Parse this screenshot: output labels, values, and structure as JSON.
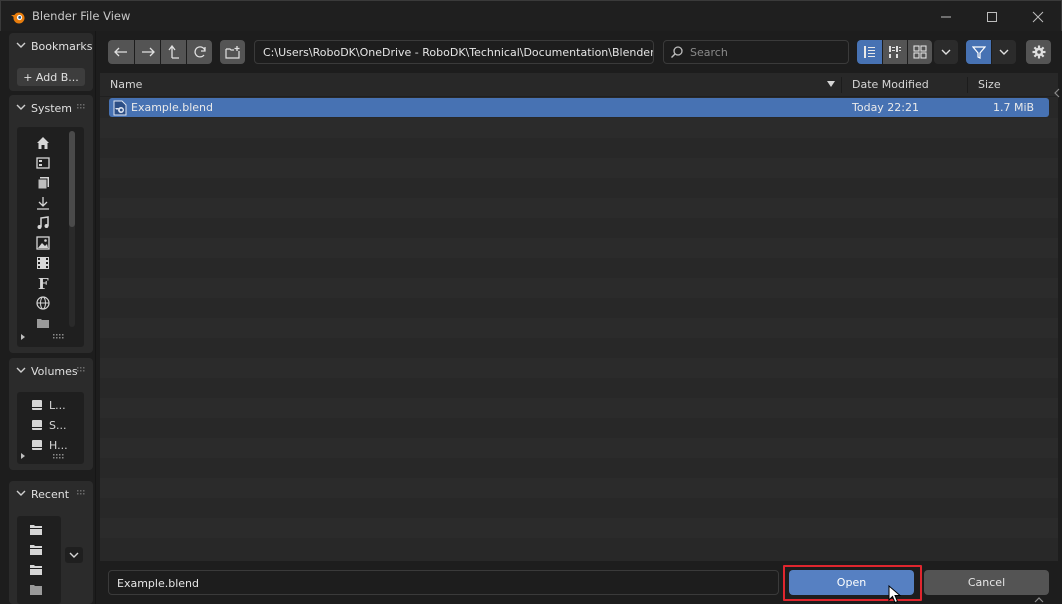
{
  "window": {
    "title": "Blender File View"
  },
  "sidebar": {
    "bookmarks": {
      "title": "Bookmarks",
      "add_label": "+ Add B..."
    },
    "system": {
      "title": "System",
      "items": [
        "home-icon",
        "desktop-icon",
        "documents-icon",
        "downloads-icon",
        "music-icon",
        "pictures-icon",
        "videos-icon",
        "fonts-icon",
        "network-icon",
        "folder-icon"
      ]
    },
    "volumes": {
      "title": "Volumes",
      "items": [
        "L...",
        "S...",
        "H..."
      ]
    },
    "recent": {
      "title": "Recent"
    }
  },
  "toolbar": {
    "path": "C:\\Users\\RoboDK\\OneDrive - RoboDK\\Technical\\Documentation\\Blender\\",
    "search_placeholder": "Search"
  },
  "filelist": {
    "columns": {
      "name": "Name",
      "date": "Date Modified",
      "size": "Size"
    },
    "files": [
      {
        "name": "Example.blend",
        "date": "Today 22:21",
        "size": "1.7 MiB",
        "selected": true
      }
    ]
  },
  "footer": {
    "filename": "Example.blend",
    "open_label": "Open",
    "cancel_label": "Cancel"
  },
  "colors": {
    "accent": "#4772b3",
    "open_button": "#5680c2",
    "highlight": "#e0262e"
  }
}
